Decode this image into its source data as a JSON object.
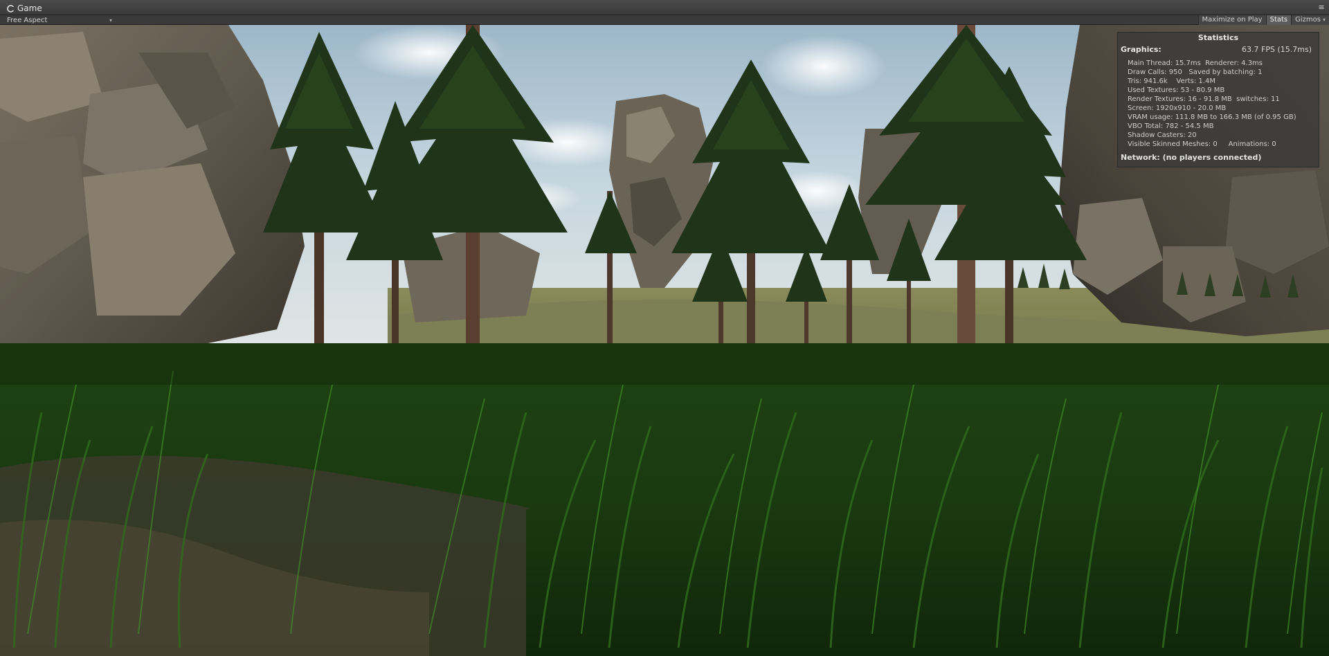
{
  "window": {
    "tab_label": "Game",
    "menu_glyph": "≡"
  },
  "toolbar": {
    "aspect_value": "Free Aspect",
    "maximize_label": "Maximize on Play",
    "stats_label": "Stats",
    "gizmos_label": "Gizmos"
  },
  "statistics": {
    "title": "Statistics",
    "graphics_label": "Graphics:",
    "fps": "63.7 FPS (15.7ms)",
    "lines": [
      "Main Thread: 15.7ms  Renderer: 4.3ms",
      "Draw Calls: 950   Saved by batching: 1",
      "Tris: 941.6k    Verts: 1.4M",
      "Used Textures: 53 - 80.9 MB",
      "Render Textures: 16 - 91.8 MB  switches: 11",
      "Screen: 1920x910 - 20.0 MB",
      "VRAM usage: 111.8 MB to 166.3 MB (of 0.95 GB)",
      "VBO Total: 782 - 54.5 MB",
      "Shadow Casters: 20",
      "Visible Skinned Meshes: 0     Animations: 0"
    ],
    "network": "Network: (no players connected)"
  },
  "colors": {
    "editor_chrome": "#3b3b3b",
    "sky": "#b9cfdc",
    "grass": "#1f4a14",
    "rock": "#6e6658",
    "bark": "#5a3e30"
  },
  "icons": {
    "tab": "unity-logo-icon",
    "menu": "panel-menu-icon",
    "dropdown": "chevron-down-icon"
  }
}
